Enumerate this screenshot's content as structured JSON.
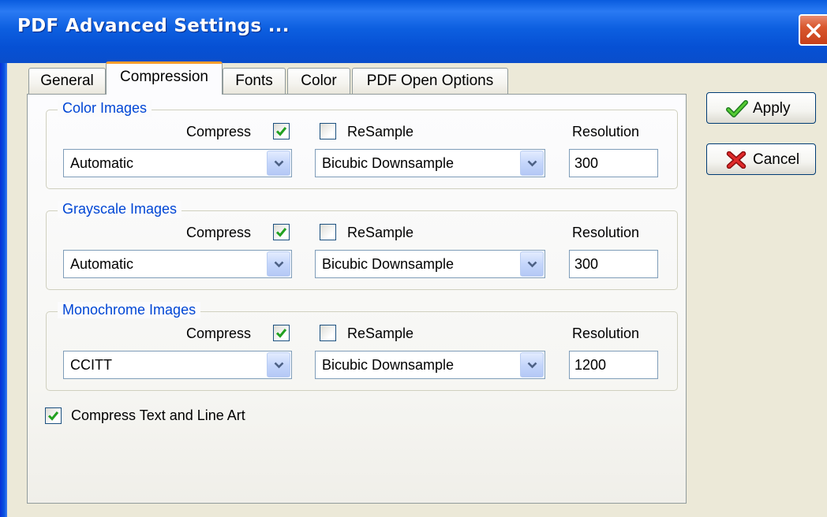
{
  "window": {
    "title": "PDF Advanced Settings ..."
  },
  "tabs": [
    {
      "label": "General"
    },
    {
      "label": "Compression"
    },
    {
      "label": "Fonts"
    },
    {
      "label": "Color"
    },
    {
      "label": "PDF Open Options"
    }
  ],
  "active_tab": "Compression",
  "groups": {
    "color": {
      "title": "Color Images",
      "compress_label": "Compress",
      "compress_checked": true,
      "resample_label": "ReSample",
      "resample_checked": false,
      "resolution_label": "Resolution",
      "method": "Automatic",
      "downsample": "Bicubic Downsample",
      "resolution": "300"
    },
    "grayscale": {
      "title": "Grayscale Images",
      "compress_label": "Compress",
      "compress_checked": true,
      "resample_label": "ReSample",
      "resample_checked": false,
      "resolution_label": "Resolution",
      "method": "Automatic",
      "downsample": "Bicubic Downsample",
      "resolution": "300"
    },
    "monochrome": {
      "title": "Monochrome Images",
      "compress_label": "Compress",
      "compress_checked": true,
      "resample_label": "ReSample",
      "resample_checked": false,
      "resolution_label": "Resolution",
      "method": "CCITT",
      "downsample": "Bicubic Downsample",
      "resolution": "1200"
    }
  },
  "compress_text": {
    "label": "Compress Text and Line Art",
    "checked": true
  },
  "buttons": {
    "apply": "Apply",
    "cancel": "Cancel"
  },
  "colors": {
    "titlebar": "#0a5cde",
    "group_title": "#0046d5",
    "check": "#21a121",
    "active_tab_accent": "#ff9d2d",
    "cancel_icon": "#d42020"
  }
}
